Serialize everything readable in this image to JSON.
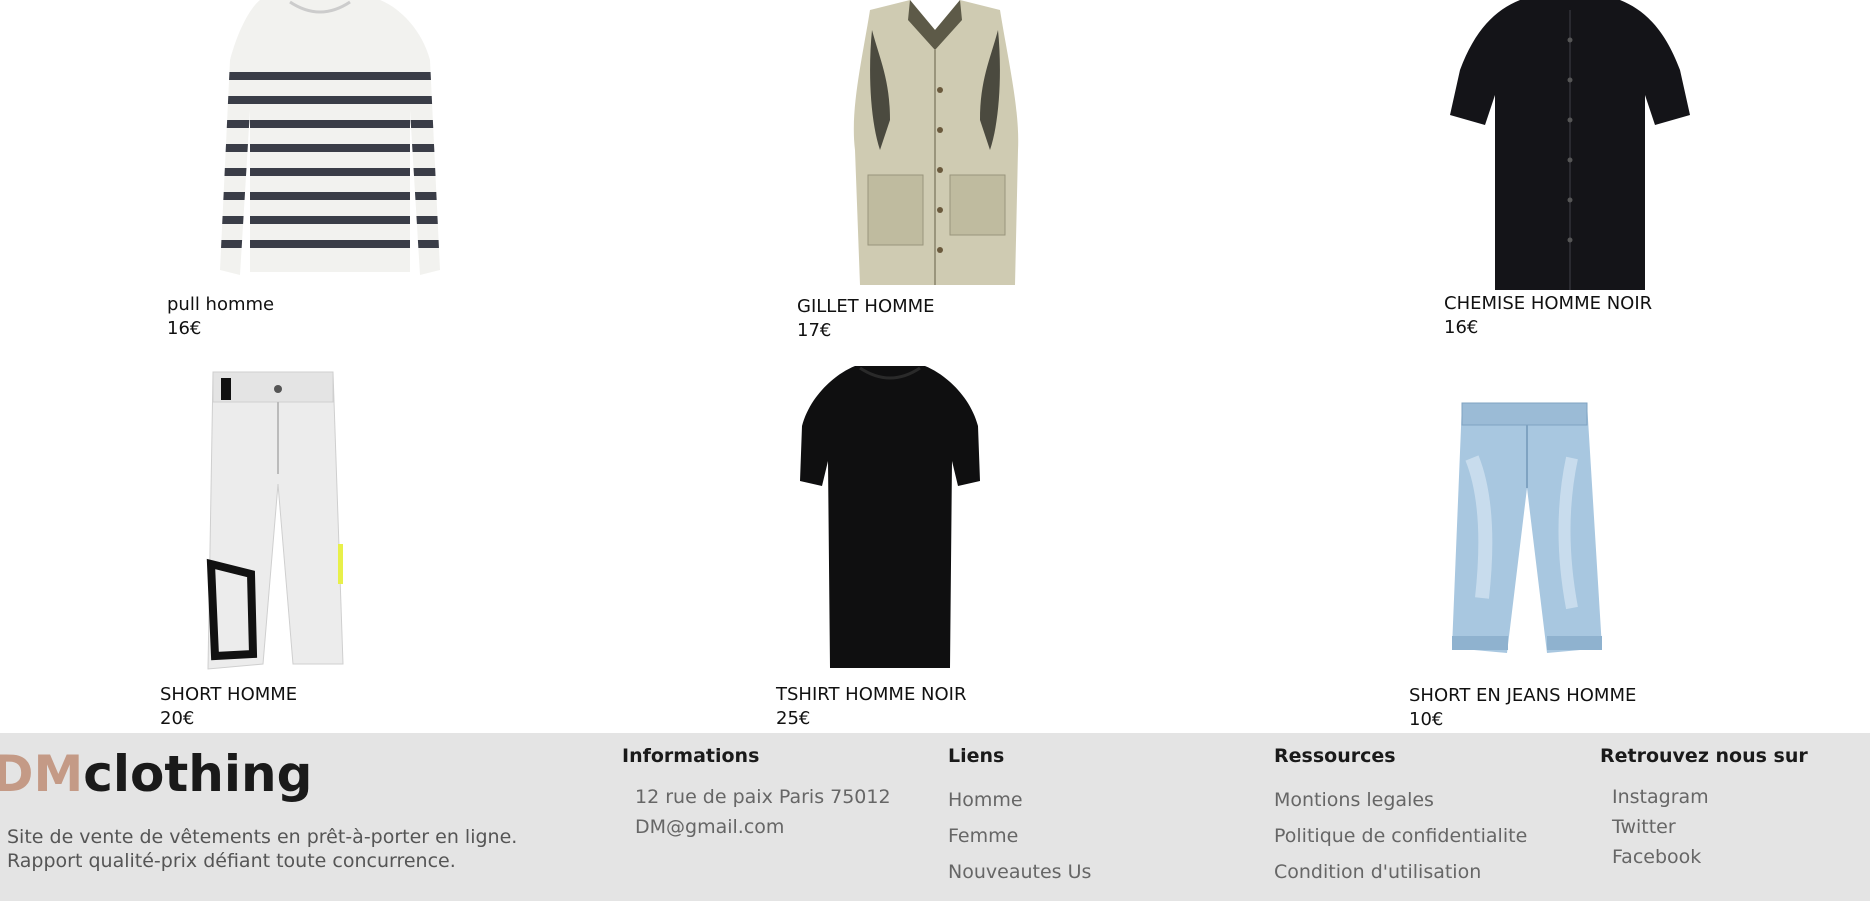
{
  "products": [
    {
      "name": "pull homme",
      "price": "16€",
      "image_icon": "striped-sweater-image"
    },
    {
      "name": "GILLET HOMME",
      "price": "17€",
      "image_icon": "beige-vest-image"
    },
    {
      "name": "CHEMISE HOMME NOIR",
      "price": "16€",
      "image_icon": "black-shirt-image"
    },
    {
      "name": "SHORT HOMME",
      "price": "20€",
      "image_icon": "white-shorts-image"
    },
    {
      "name": "TSHIRT HOMME NOIR",
      "price": "25€",
      "image_icon": "black-tshirt-image"
    },
    {
      "name": "SHORT EN JEANS HOMME",
      "price": "10€",
      "image_icon": "denim-shorts-image"
    }
  ],
  "footer": {
    "brand_accent": "DM",
    "brand_rest": "clothing",
    "tagline_line1": "Site de vente de vêtements en prêt-à-porter en ligne.",
    "tagline_line2": "Rapport qualité-prix défiant toute concurrence.",
    "informations": {
      "title": "Informations",
      "items": [
        "12 rue de paix Paris 75012",
        "DM@gmail.com"
      ]
    },
    "liens": {
      "title": "Liens",
      "items": [
        "Homme",
        "Femme",
        "Nouveautes Us"
      ]
    },
    "ressources": {
      "title": "Ressources",
      "items": [
        "Montions legales",
        "Politique de confidentialite",
        "Condition d'utilisation"
      ]
    },
    "social": {
      "title": "Retrouvez nous sur",
      "items": [
        "Instagram",
        "Twitter",
        "Facebook"
      ]
    }
  },
  "colors": {
    "footer_bg": "#e4e4e4",
    "brand_accent": "#c49a86",
    "text": "#111111"
  }
}
